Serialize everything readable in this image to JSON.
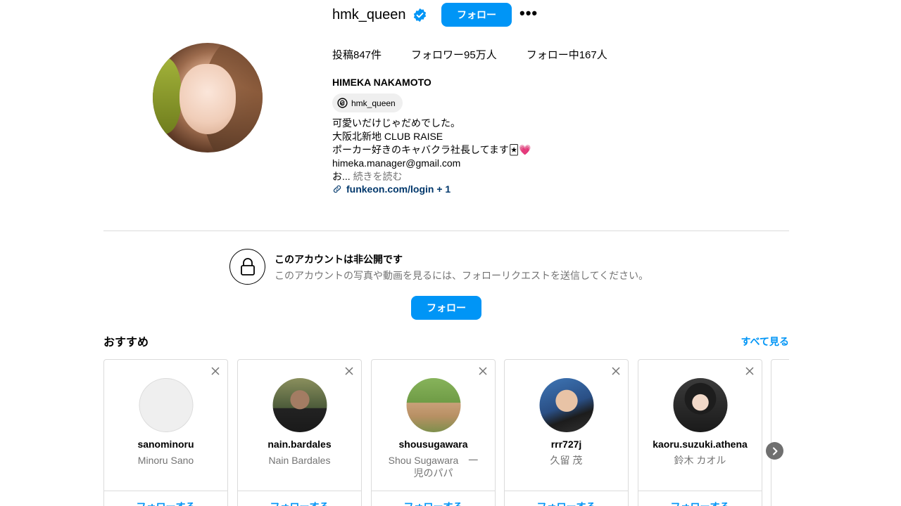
{
  "header": {
    "username": "hmk_queen",
    "follow_label": "フォロー",
    "more_label": "•••",
    "stats": {
      "posts": "投稿847件",
      "followers": "フォロワー95万人",
      "following": "フォロー中167人"
    },
    "display_name": "HIMEKA NAKAMOTO",
    "threads_handle": "hmk_queen",
    "bio_lines": [
      "可愛いだけじゃだめでした。",
      "大阪北新地 CLUB RAISE",
      "ポーカー好きのキャバクラ社長してます🃏💗",
      "himeka.manager@gmail.com"
    ],
    "bio_truncated": "お...",
    "read_more": "続きを読む",
    "link": "funkeon.com/login + 1"
  },
  "private": {
    "title": "このアカウントは非公開です",
    "description": "このアカウントの写真や動画を見るには、フォローリクエストを送信してください。",
    "follow_label": "フォロー"
  },
  "suggestions": {
    "heading": "おすすめ",
    "see_all": "すべて見る",
    "follow_label": "フォローする",
    "items": [
      {
        "handle": "sanominoru",
        "name": "Minoru Sano"
      },
      {
        "handle": "nain.bardales",
        "name": "Nain Bardales"
      },
      {
        "handle": "shousugawara",
        "name": "Shou Sugawara　一児のパパ"
      },
      {
        "handle": "rrr727j",
        "name": "久留 茂"
      },
      {
        "handle": "kaoru.suzuki.athena",
        "name": "鈴木 カオル"
      }
    ]
  },
  "colors": {
    "accent": "#0095f6",
    "link": "#00376b",
    "muted": "#737373",
    "border": "#dbdbdb"
  }
}
